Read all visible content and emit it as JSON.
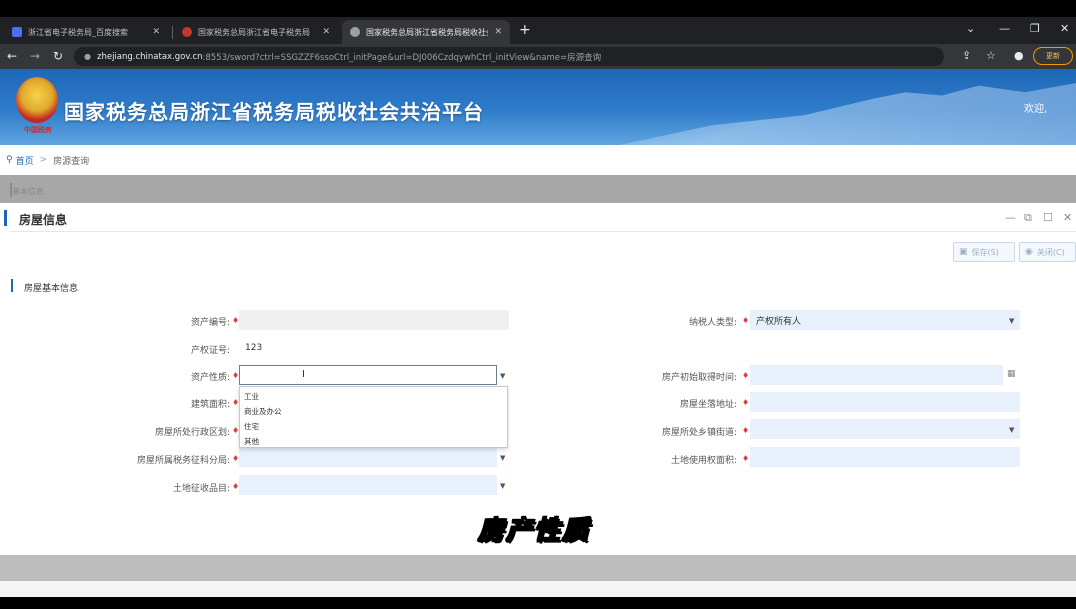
{
  "browser": {
    "tabs": [
      {
        "title": "浙江省电子税务局_百度搜索",
        "close": "✕",
        "favicon_color": "#4e6ef2"
      },
      {
        "title": "国家税务总局浙江省电子税务局",
        "close": "✕",
        "favicon_color": "#c0392b"
      },
      {
        "title": "国家税务总局浙江省税务局税收社会",
        "close": "✕",
        "favicon_color": "#9aa0a6"
      }
    ],
    "new_tab": "+",
    "window_controls": {
      "dropdown": "⌄",
      "minimize": "—",
      "restore": "❐",
      "close": "✕"
    },
    "nav": {
      "back": "←",
      "forward": "→",
      "reload": "↻"
    },
    "url_host": "zhejiang.chinatax.gov.cn",
    "url_path": ":8553/sword?ctrl=SSGZZF6ssoCtrl_initPage&url=DJ006CzdqywhCtrl_initView&name=房源查询",
    "update_label": "更新"
  },
  "banner": {
    "title": "国家税务总局浙江省税务局税收社会共治平台",
    "emblem_text": "中国税务",
    "welcome": "欢迎,"
  },
  "breadcrumb": {
    "home": "首页",
    "separator": ">",
    "current": "房源查询"
  },
  "behind_label": "基本信息",
  "modal": {
    "title": "房屋信息",
    "controls": {
      "minimize": "—",
      "restore": "⧉",
      "maximize": "☐",
      "close": "✕"
    },
    "actions": [
      {
        "label": "保存(S)",
        "icon": "▣"
      },
      {
        "label": "关闭(C)",
        "icon": "◉"
      }
    ],
    "section_title": "房屋基本信息",
    "fields": {
      "fcbh": {
        "label": "资产编号:",
        "value": ""
      },
      "nsrlx": {
        "label": "纳税人类型:",
        "value": "产权所有人"
      },
      "cqzh": {
        "label": "产权证号:",
        "value": "123"
      },
      "fcxz": {
        "label": "资产性质:",
        "value": ""
      },
      "qdsj": {
        "label": "房产初始取得时间:",
        "value": ""
      },
      "jzmj": {
        "label": "建筑面积:",
        "value": ""
      },
      "zldz": {
        "label": "房屋坐落地址:",
        "value": ""
      },
      "xzqh": {
        "label": "房屋所处行政区划:",
        "value": ""
      },
      "jdxz": {
        "label": "房屋所处乡镇街道:",
        "value": ""
      },
      "swfj": {
        "label": "房屋所属税务征科分局:",
        "value": ""
      },
      "tdmj": {
        "label": "土地使用权面积:",
        "value": ""
      },
      "tdsmc": {
        "label": "土地征收品目:",
        "value": ""
      }
    },
    "dropdown_options": [
      "工业",
      "商业及办公",
      "住宅",
      "其他"
    ]
  },
  "video_subtitle": "房产性质",
  "colors": {
    "accent": "#1d67b6",
    "required": "#e23a3a",
    "field_bg": "#e8f1fb"
  }
}
